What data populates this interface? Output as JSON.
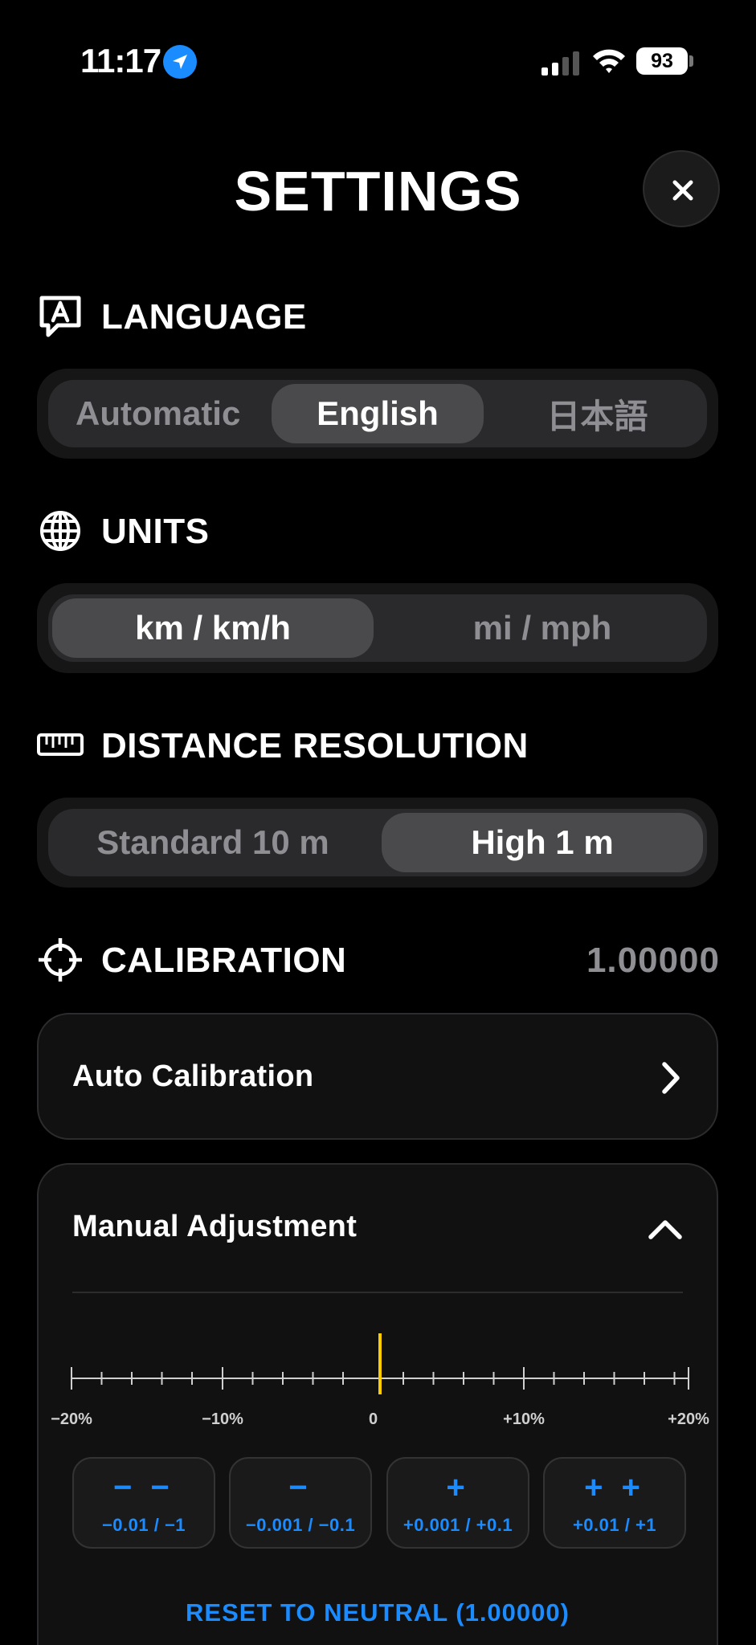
{
  "status_bar": {
    "time": "11:17",
    "battery": "93"
  },
  "header": {
    "title": "SETTINGS"
  },
  "sections": {
    "language": {
      "title": "LANGUAGE",
      "options": [
        "Automatic",
        "English",
        "日本語"
      ],
      "selected": "English"
    },
    "units": {
      "title": "UNITS",
      "options": [
        "km / km/h",
        "mi / mph"
      ],
      "selected": "km / km/h"
    },
    "distance_resolution": {
      "title": "DISTANCE RESOLUTION",
      "options": [
        "Standard 10 m",
        "High 1 m"
      ],
      "selected": "High 1 m"
    },
    "calibration": {
      "title": "CALIBRATION",
      "value": "1.00000",
      "auto_calibration_label": "Auto Calibration",
      "manual_adjustment": {
        "title": "Manual Adjustment",
        "ruler_labels": [
          "−20%",
          "−10%",
          "0",
          "+10%",
          "+20%"
        ],
        "ruler_marker_value_percent": 0,
        "buttons": [
          {
            "glyph": "− −",
            "label": "−0.01 / −1"
          },
          {
            "glyph": "−",
            "label": "−0.001 / −0.1"
          },
          {
            "glyph": "+",
            "label": "+0.001 / +0.1"
          },
          {
            "glyph": "+ +",
            "label": "+0.01 / +1"
          }
        ],
        "reset_label": "RESET TO NEUTRAL (1.00000)"
      }
    }
  },
  "colors": {
    "accent": "#1a8cff",
    "marker": "#ffcc00",
    "background": "#000000",
    "muted_text": "#8e8e93"
  },
  "icons": {
    "location": "location-arrow-icon",
    "close": "close-icon",
    "language": "speech-bubble-letter-a-icon",
    "units": "globe-icon",
    "distance": "ruler-icon",
    "calibration": "crosshair-icon",
    "auto_calibration": "chevron-right-icon",
    "manual_adjustment": "chevron-up-icon"
  }
}
